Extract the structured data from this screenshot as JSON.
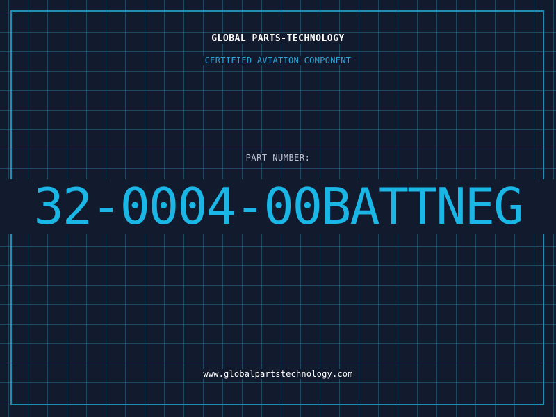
{
  "header": {
    "brand": "GLOBAL PARTS-TECHNOLOGY",
    "subtitle": "CERTIFIED AVIATION COMPONENT"
  },
  "part": {
    "label": "PART NUMBER:",
    "number": "32-0004-00BATTNEG"
  },
  "footer": {
    "website": "www.globalpartstechnology.com"
  },
  "colors": {
    "background": "#121a2e",
    "grid": "#286e8c",
    "frame": "#1e8fb0",
    "accent": "#19b6e6",
    "subtitle": "#2aa6d6",
    "label": "#b9c2d0",
    "text": "#ffffff"
  }
}
